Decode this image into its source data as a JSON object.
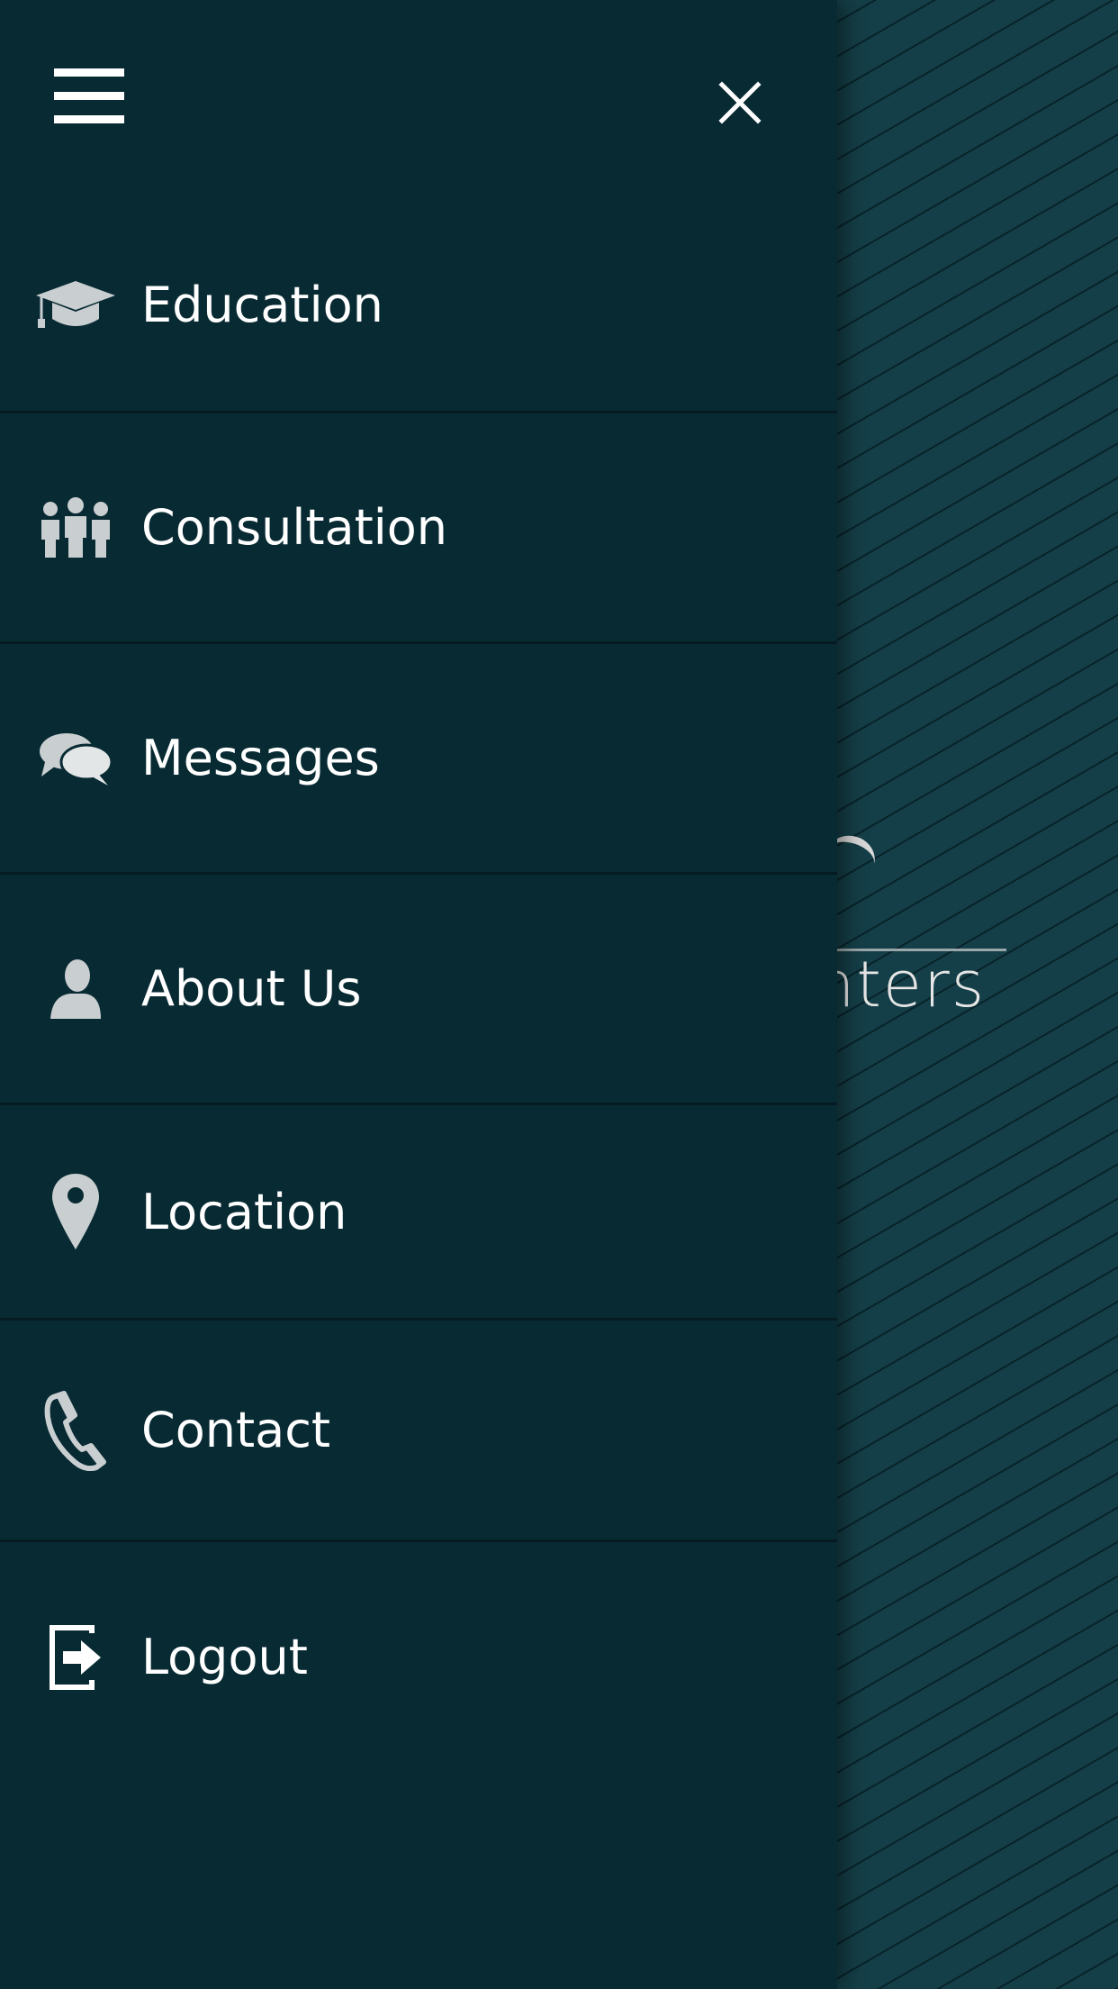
{
  "background": {
    "logo_text": "enters"
  },
  "header": {
    "menu_icon": "hamburger-icon",
    "close_icon": "close-icon"
  },
  "menu": {
    "items": [
      {
        "label": "Education",
        "icon": "graduation-cap-icon"
      },
      {
        "label": "Consultation",
        "icon": "group-icon"
      },
      {
        "label": "Messages",
        "icon": "chat-bubbles-icon"
      },
      {
        "label": "About Us",
        "icon": "user-icon"
      },
      {
        "label": "Location",
        "icon": "map-pin-icon"
      },
      {
        "label": "Contact",
        "icon": "phone-icon"
      },
      {
        "label": "Logout",
        "icon": "logout-icon"
      }
    ]
  },
  "colors": {
    "drawer_bg": "#082a33",
    "background": "#153f48",
    "divider": "#051b21",
    "icon": "#c9cfd0",
    "text": "#ffffff"
  }
}
